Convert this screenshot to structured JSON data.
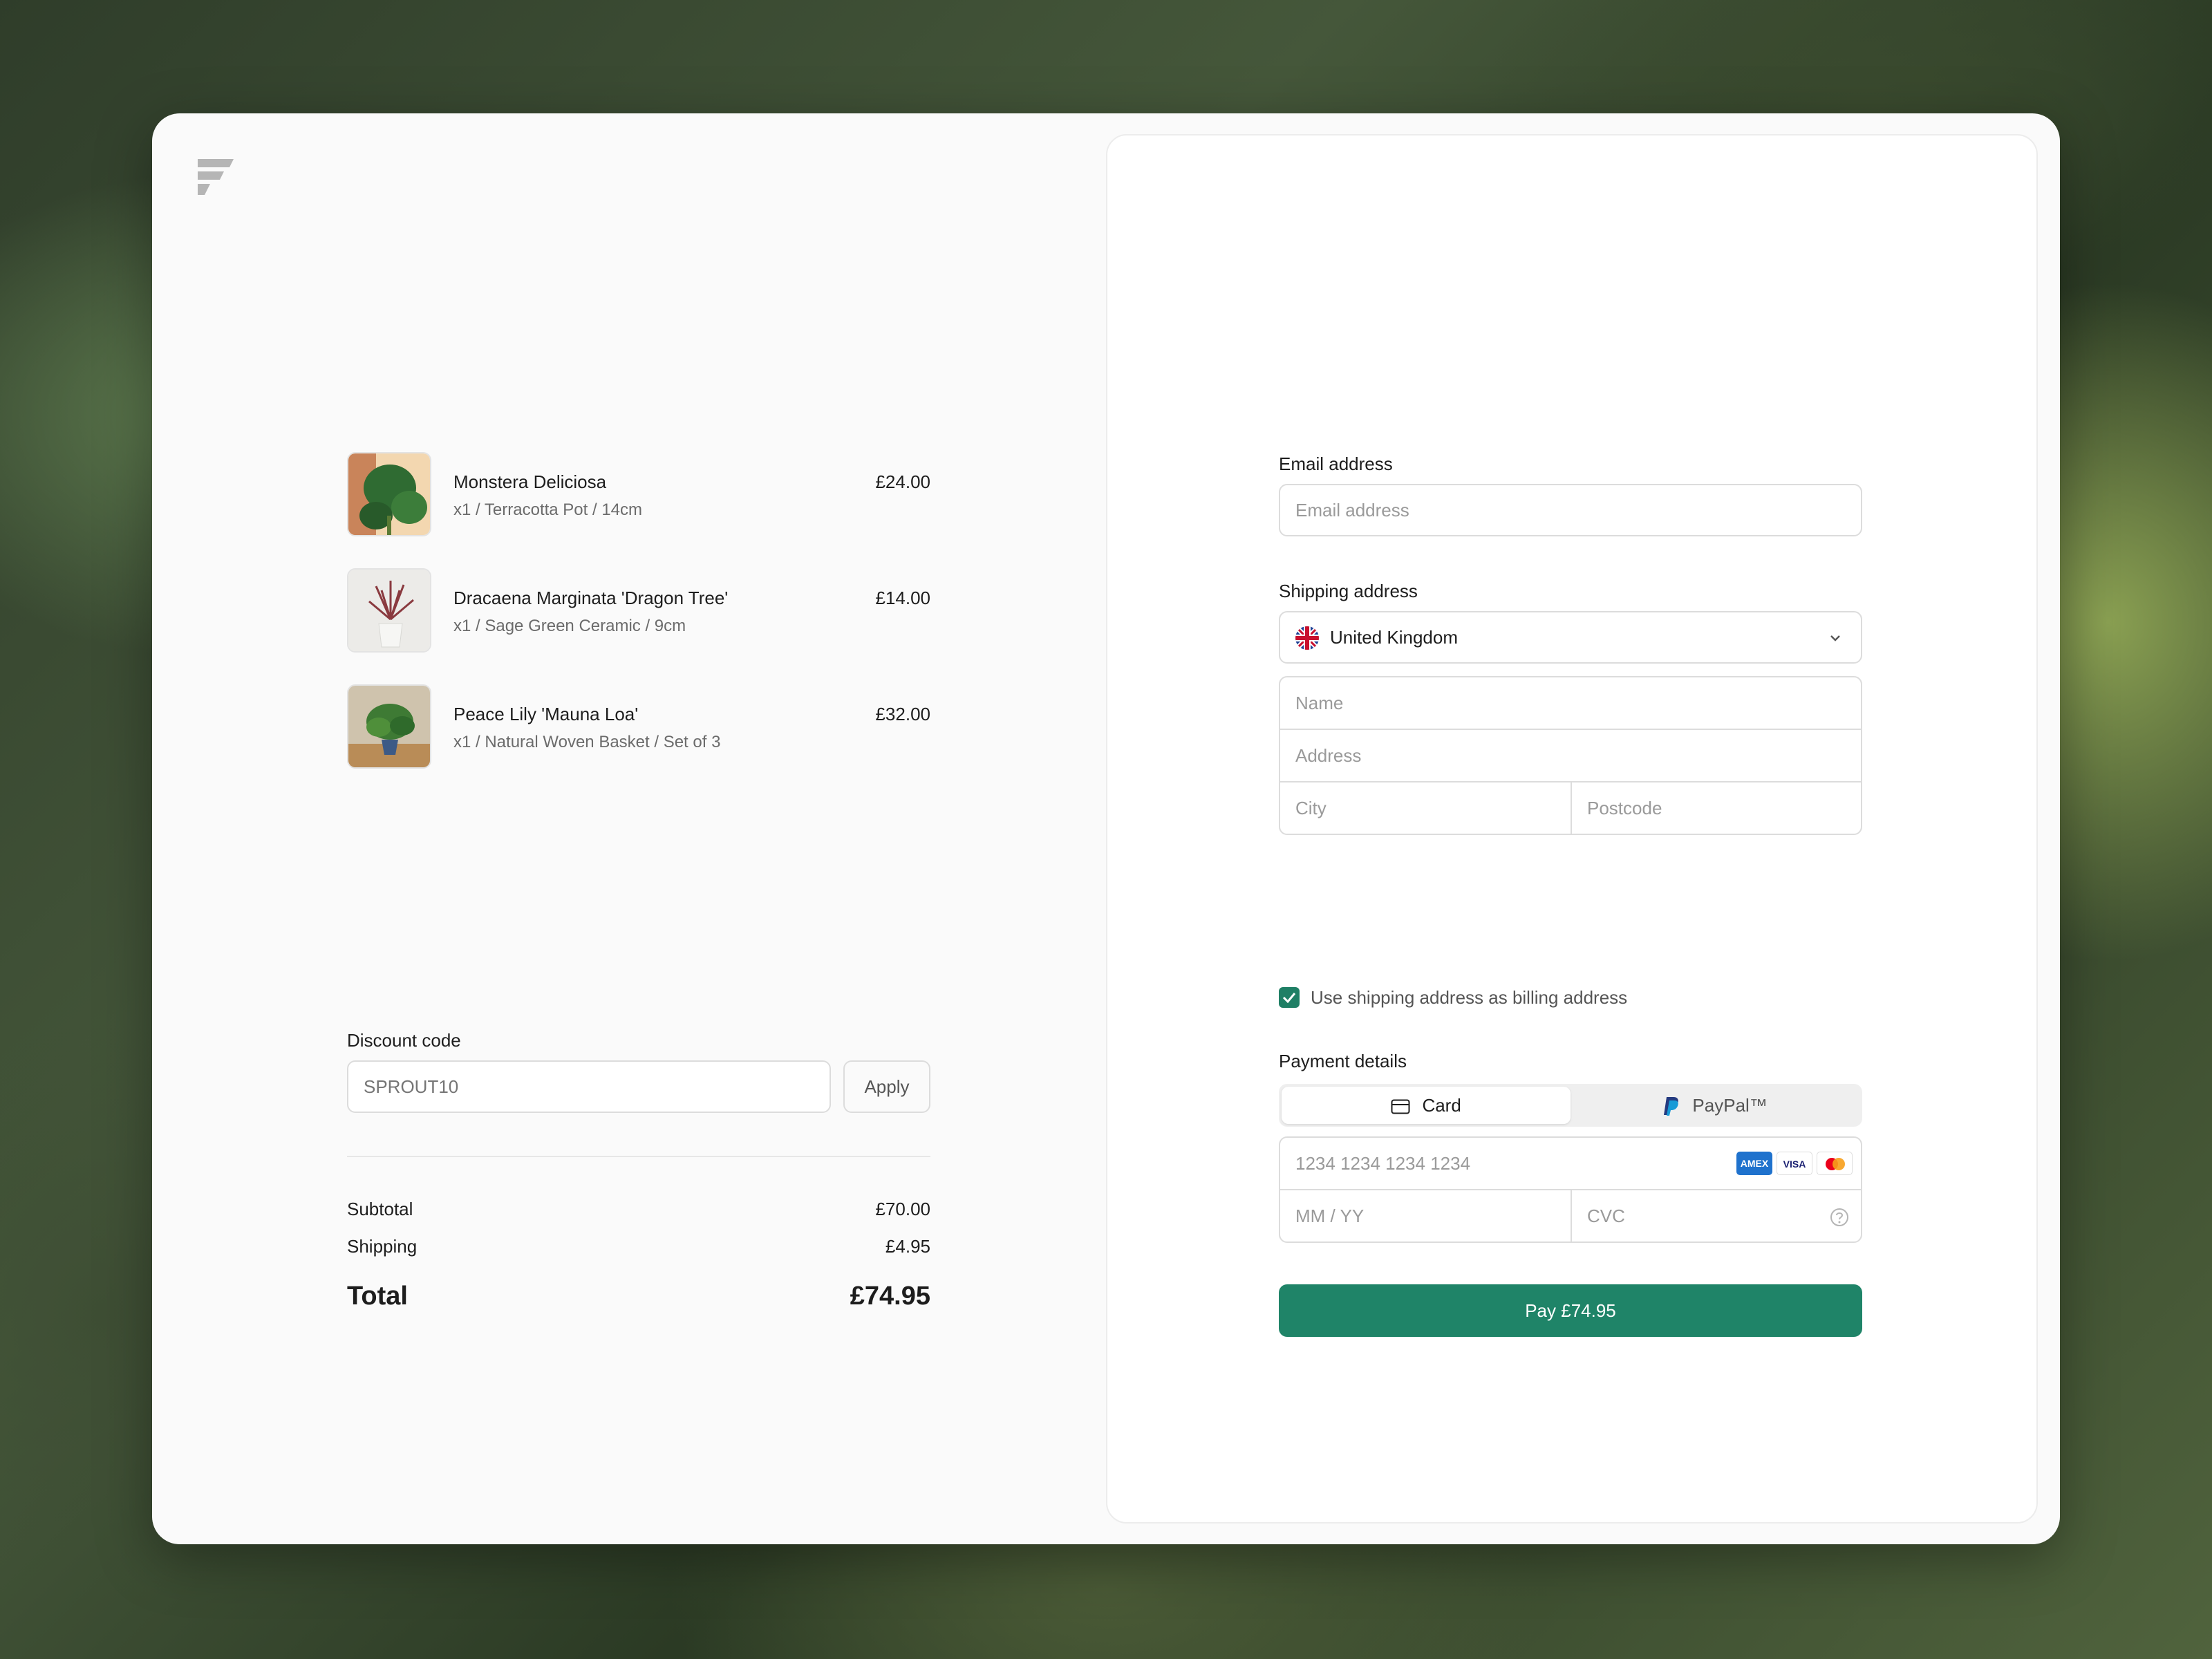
{
  "order": {
    "items": [
      {
        "name": "Monstera Deliciosa",
        "variant": "x1 / Terracotta Pot / 14cm",
        "price": "£24.00"
      },
      {
        "name": "Dracaena Marginata 'Dragon Tree'",
        "variant": "x1 / Sage Green Ceramic / 9cm",
        "price": "£14.00"
      },
      {
        "name": "Peace Lily 'Mauna Loa'",
        "variant": "x1 / Natural Woven Basket / Set of 3",
        "price": "£32.00"
      }
    ],
    "discount": {
      "label": "Discount code",
      "placeholder": "SPROUT10",
      "apply_label": "Apply"
    },
    "summary": {
      "subtotal_label": "Subtotal",
      "subtotal": "£70.00",
      "shipping_label": "Shipping",
      "shipping": "£4.95",
      "total_label": "Total",
      "total": "£74.95"
    }
  },
  "checkout": {
    "email": {
      "label": "Email address",
      "placeholder": "Email address"
    },
    "shipping": {
      "label": "Shipping address",
      "country": "United Kingdom",
      "name_placeholder": "Name",
      "address_placeholder": "Address",
      "city_placeholder": "City",
      "postcode_placeholder": "Postcode",
      "billing_same_label": "Use shipping address as billing address",
      "billing_same_checked": true
    },
    "payment": {
      "label": "Payment details",
      "tab_card": "Card",
      "tab_paypal": "PayPal™",
      "card_number_placeholder": "1234 1234 1234 1234",
      "expiry_placeholder": "MM / YY",
      "cvc_placeholder": "CVC",
      "brands": [
        "AMEX",
        "VISA",
        "mastercard"
      ]
    },
    "pay_button": "Pay £74.95"
  },
  "colors": {
    "accent": "#1f8468",
    "checkbox": "#1f7f65"
  }
}
